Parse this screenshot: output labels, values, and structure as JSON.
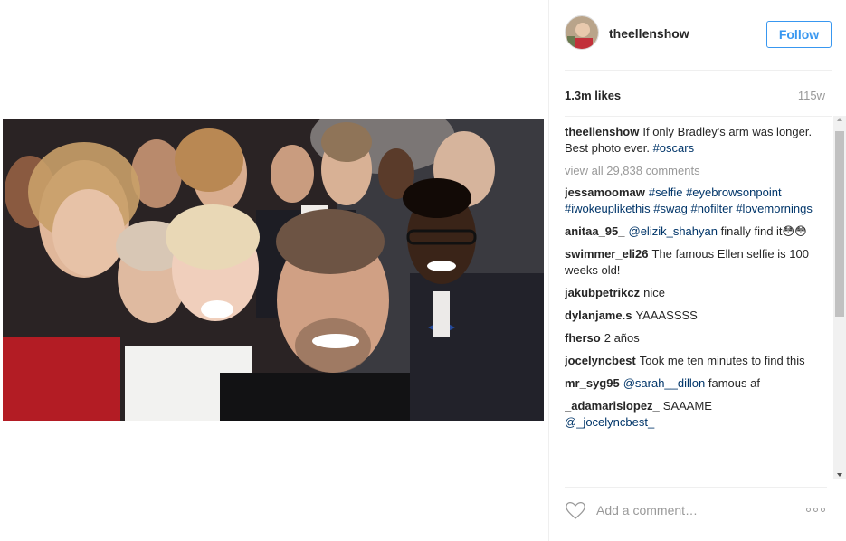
{
  "post": {
    "username": "theellenshow",
    "follow_label": "Follow",
    "likes": "1.3m likes",
    "age": "115w"
  },
  "caption": {
    "user": "theellenshow",
    "text": "If only Bradley's arm was longer. Best photo ever.",
    "hashtag": "#oscars"
  },
  "view_all": "view all 29,838 comments",
  "comments": [
    {
      "user": "jessamoomaw",
      "text": "",
      "tags": "#selfie #eyebrowsonpoint #iwokeuplikethis #swag #nofilter #lovemornings"
    },
    {
      "user": "anitaa_95_",
      "mention": "@elizik_shahyan",
      "text": "finally find it😳😳"
    },
    {
      "user": "swimmer_eli26",
      "text": "The famous Ellen selfie is 100 weeks old!"
    },
    {
      "user": "jakubpetrikcz",
      "text": "nice"
    },
    {
      "user": "dylanjame.s",
      "text": "YAAASSSS"
    },
    {
      "user": "fherso",
      "text": "2 años"
    },
    {
      "user": "jocelyncbest",
      "text": "Took me ten minutes to find this"
    },
    {
      "user": "mr_syg95",
      "mention": "@sarah__dillon",
      "text": "famous af"
    },
    {
      "user": "_adamarislopez_",
      "text": "SAAAME",
      "mention2": "@_jocelyncbest_"
    }
  ],
  "footer": {
    "add_comment_placeholder": "Add a comment…"
  },
  "colors": {
    "accent": "#3897f0",
    "hashtag": "#003569",
    "muted": "#999999"
  },
  "icons": [
    "heart-icon",
    "more-options-icon",
    "avatar"
  ]
}
